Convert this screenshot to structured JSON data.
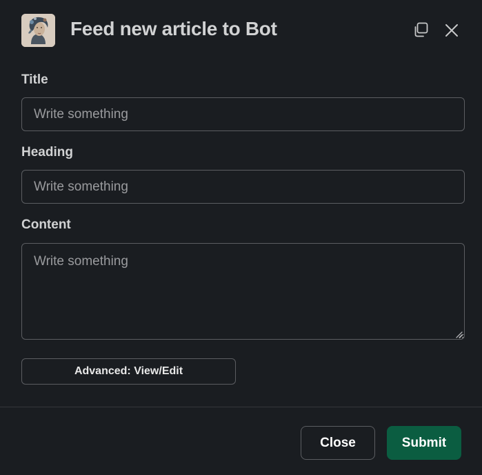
{
  "modal": {
    "title": "Feed new article to Bot",
    "app_icon": "ai-face-avatar-icon",
    "popout_icon": "popout-window-icon",
    "close_icon": "close-icon"
  },
  "form": {
    "fields": [
      {
        "label": "Title",
        "placeholder": "Write something",
        "value": ""
      },
      {
        "label": "Heading",
        "placeholder": "Write something",
        "value": ""
      },
      {
        "label": "Content",
        "placeholder": "Write something",
        "value": ""
      }
    ],
    "advanced_button": "Advanced: View/Edit"
  },
  "footer": {
    "close_label": "Close",
    "submit_label": "Submit"
  },
  "colors": {
    "background": "#1a1d21",
    "border": "#5c5e62",
    "text": "#d1d2d3",
    "placeholder": "#9a9b9e",
    "submit": "#0b5d41"
  }
}
